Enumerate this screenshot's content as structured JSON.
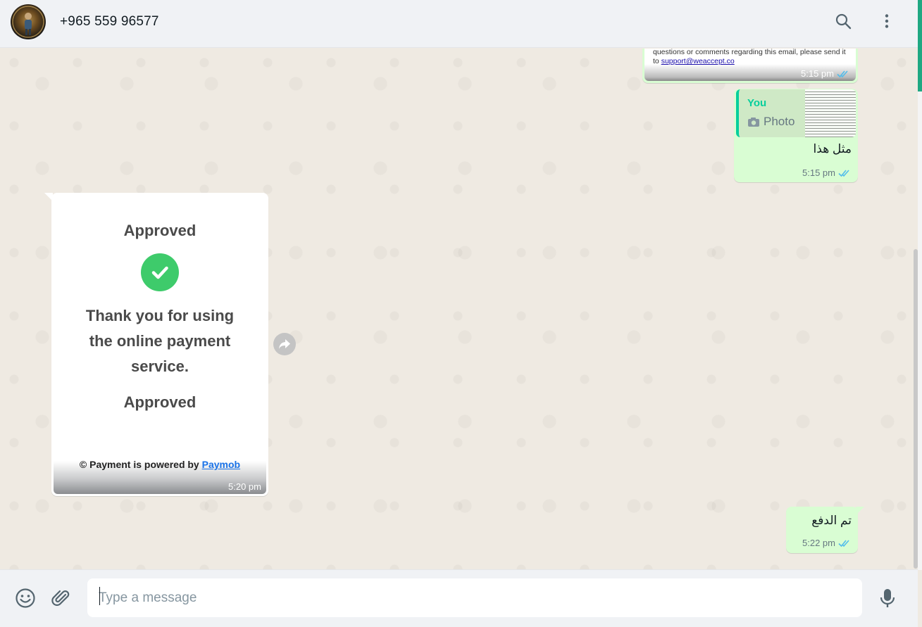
{
  "header": {
    "contact_name": "+965 559 96577",
    "icons": [
      "search-icon",
      "menu-icon"
    ]
  },
  "messages": [
    {
      "direction": "outgoing",
      "kind": "image",
      "image_text": "questions or comments regarding this email, please send it to",
      "image_link": "support@weaccept.co",
      "time": "5:15 pm",
      "status": "read"
    },
    {
      "direction": "outgoing",
      "kind": "reply",
      "quote_author": "You",
      "quote_kind": "Photo",
      "text": "مثل هذا",
      "time": "5:15 pm",
      "status": "read"
    },
    {
      "direction": "incoming",
      "kind": "image",
      "receipt_title": "Approved",
      "receipt_message": "Thank you for using the online payment service.",
      "receipt_status": "Approved",
      "receipt_footer_prefix": "© Payment is powered by",
      "receipt_footer_link": "Paymob",
      "time": "5:20 pm"
    },
    {
      "direction": "outgoing",
      "kind": "text",
      "text": "تم الدفع",
      "time": "5:22 pm",
      "status": "read"
    }
  ],
  "composer": {
    "placeholder": "Type a message",
    "icons": [
      "emoji-icon",
      "attach-icon",
      "mic-icon"
    ]
  },
  "colors": {
    "accent": "#06cf9c",
    "outgoing_bubble": "#d9fdd3",
    "incoming_bubble": "#ffffff",
    "read_ticks": "#53bdeb",
    "chat_background": "#efeae2"
  }
}
